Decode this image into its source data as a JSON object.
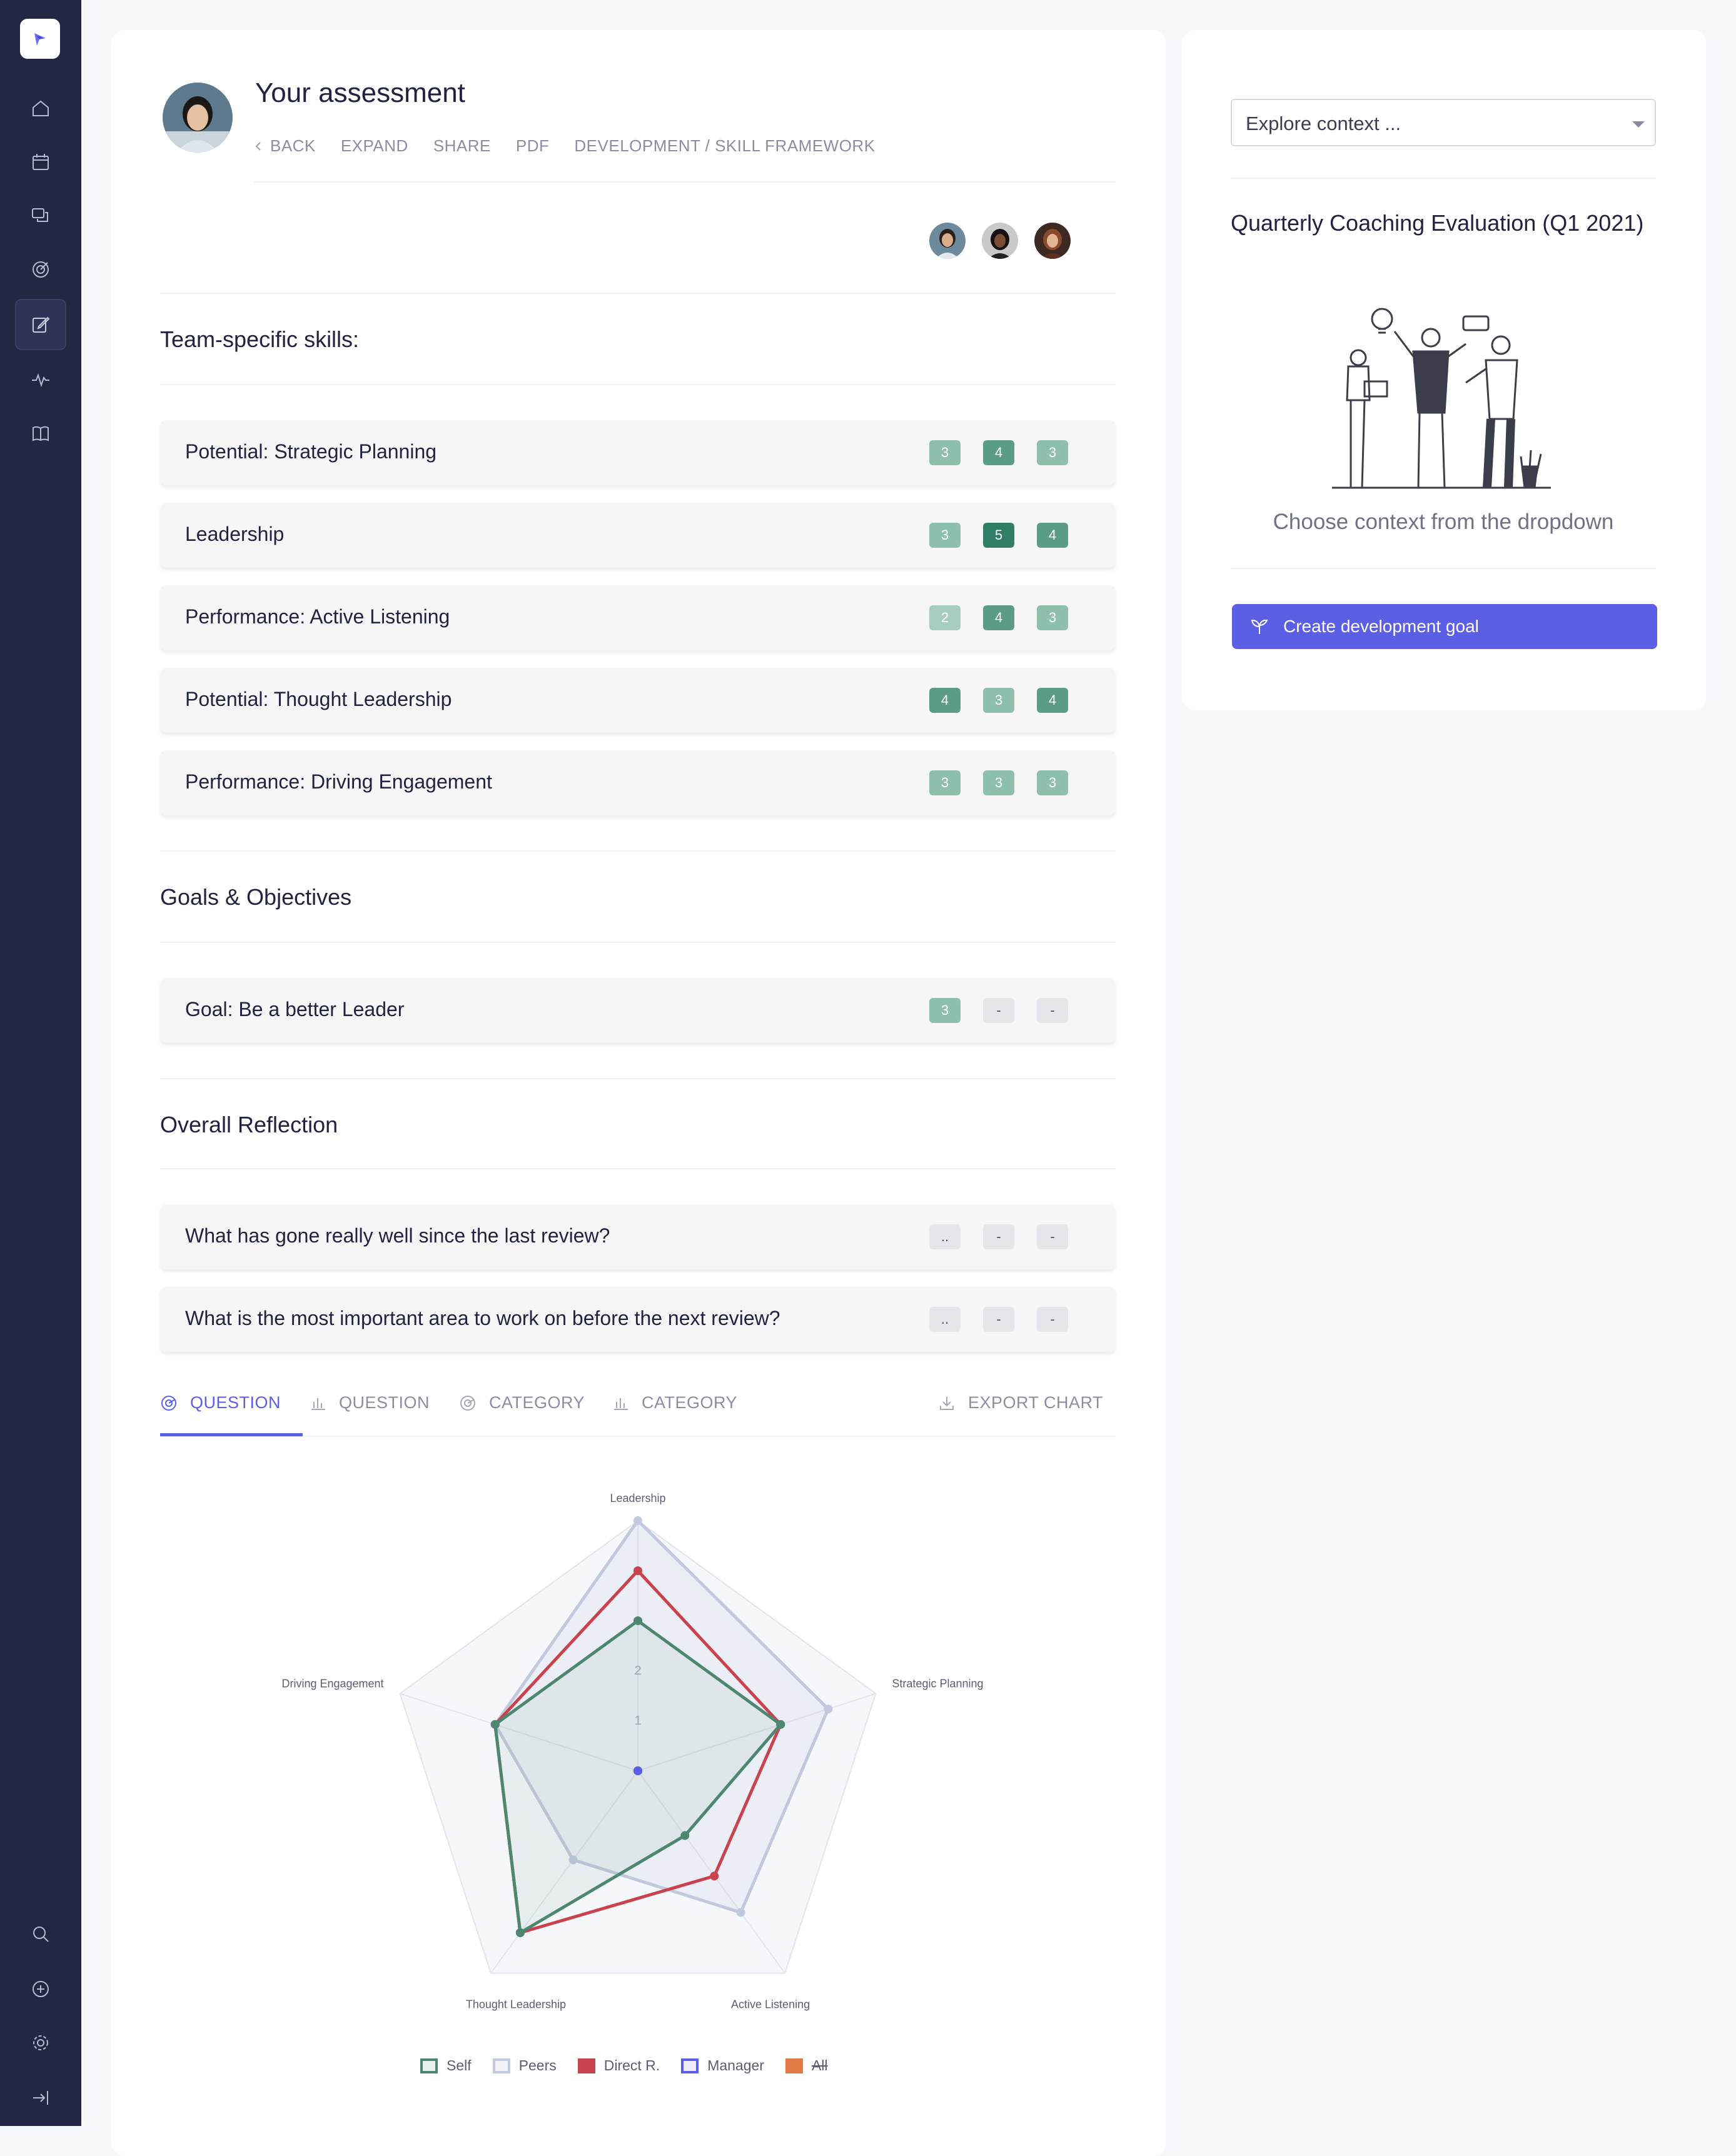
{
  "header": {
    "title": "Your assessment",
    "nav": {
      "back": "BACK",
      "expand": "EXPAND",
      "share": "SHARE",
      "pdf": "PDF",
      "breadcrumb": "DEVELOPMENT / SKILL FRAMEWORK"
    }
  },
  "sections": [
    {
      "title": "Team-specific skills:",
      "rows": [
        {
          "label": "Potential: Strategic Planning",
          "scores": [
            "3",
            "4",
            "3"
          ]
        },
        {
          "label": "Leadership",
          "scores": [
            "3",
            "5",
            "4"
          ]
        },
        {
          "label": "Performance: Active Listening",
          "scores": [
            "2",
            "4",
            "3"
          ]
        },
        {
          "label": "Potential: Thought Leadership",
          "scores": [
            "4",
            "3",
            "4"
          ]
        },
        {
          "label": "Performance: Driving Engagement",
          "scores": [
            "3",
            "3",
            "3"
          ]
        }
      ]
    },
    {
      "title": "Goals & Objectives",
      "rows": [
        {
          "label": "Goal: Be a better Leader",
          "scores": [
            "3",
            "-",
            "-"
          ]
        }
      ]
    },
    {
      "title": "Overall Reflection",
      "rows": [
        {
          "label": "What has gone really well since the last review?",
          "scores": [
            "..",
            "-",
            "-"
          ]
        },
        {
          "label": "What is the most important area to work on before the next review?",
          "scores": [
            "..",
            "-",
            "-"
          ]
        }
      ]
    }
  ],
  "chart_tabs": {
    "tab1": "QUESTION",
    "tab2": "QUESTION",
    "tab3": "CATEGORY",
    "tab4": "CATEGORY",
    "export": "EXPORT CHART",
    "active": 0
  },
  "chart_data": {
    "type": "radar",
    "axes": [
      "Leadership",
      "Strategic Planning",
      "Active Listening",
      "Thought Leadership",
      "Driving Engagement"
    ],
    "rlim": [
      0,
      5
    ],
    "tick_labels": [
      "1",
      "2"
    ],
    "series": [
      {
        "name": "Self",
        "color": "#4e8770",
        "values": [
          3,
          3,
          1.6,
          4,
          3
        ]
      },
      {
        "name": "Peers",
        "color": "#c2c8dd",
        "values": [
          5,
          4,
          3.5,
          2.2,
          3
        ]
      },
      {
        "name": "Direct R.",
        "color": "#c9434e",
        "values": [
          4,
          3,
          2.6,
          4,
          3
        ]
      },
      {
        "name": "Manager",
        "color": "#5b5fe6",
        "values": [
          0,
          0,
          0,
          0,
          0
        ]
      },
      {
        "name": "All",
        "color": "#e07b45",
        "values": [],
        "hidden": true
      }
    ],
    "legend_position": "bottom"
  },
  "right_panel": {
    "select_placeholder": "Explore context ...",
    "title": "Quarterly Coaching Evaluation (Q1 2021)",
    "empty_text": "Choose context from the dropdown",
    "cta_label": "Create development goal"
  },
  "colors": {
    "accent": "#5b5fe6",
    "sidebar": "#232743"
  }
}
